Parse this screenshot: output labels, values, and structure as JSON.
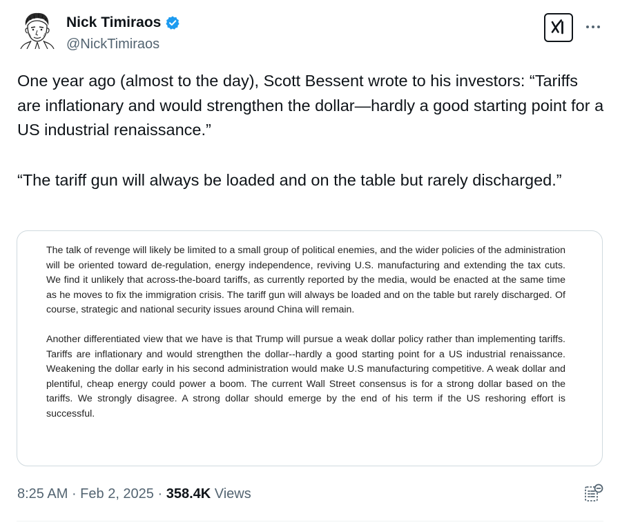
{
  "author": {
    "display_name": "Nick Timiraos",
    "handle": "@NickTimiraos",
    "verified": true,
    "avatar_icon": "sketch-portrait-avatar"
  },
  "header_icons": {
    "x_logo": "x-ai-logo-icon",
    "more": "more-dots-icon"
  },
  "tweet": {
    "paragraphs": [
      "One year ago (almost to the day), Scott Bessent wrote to his investors: “Tariffs are inflationary and would strengthen the dollar—hardly a good starting point for a US industrial renaissance.”",
      "“The tariff gun will always be loaded and on the table but rarely discharged.”"
    ]
  },
  "media": {
    "paragraphs": [
      "The talk of revenge will likely be limited to a small group of political enemies, and the wider policies of the administration will be oriented toward de-regulation, energy independence, reviving U.S. manufacturing and extending the tax cuts.  We find it unlikely that across-the-board tariffs, as currently reported by the media, would be enacted at the same time as he moves to fix the immigration crisis. The tariff gun will always be loaded and on the table but rarely discharged. Of course, strategic and national security issues around China will remain.",
      "Another differentiated view that we have is that Trump will pursue a weak dollar policy rather than implementing tariffs.  Tariffs are inflationary and would strengthen the dollar--hardly a good starting point for a US industrial renaissance.  Weakening the dollar early in his second administration would make U.S manufacturing competitive.  A weak dollar and plentiful, cheap energy could power a boom.  The current Wall Street consensus is for a strong dollar based on the tariffs.  We strongly disagree. A strong dollar should emerge by the end of his term if the US reshoring effort is successful."
    ]
  },
  "meta": {
    "time": "8:25 AM",
    "separator": " · ",
    "date": "Feb 2, 2025",
    "views_count": "358.4K",
    "views_label": " Views"
  },
  "colors": {
    "text": "#0f1419",
    "secondary": "#536471",
    "verified_blue": "#1d9bf0",
    "border": "#cfd9de"
  }
}
